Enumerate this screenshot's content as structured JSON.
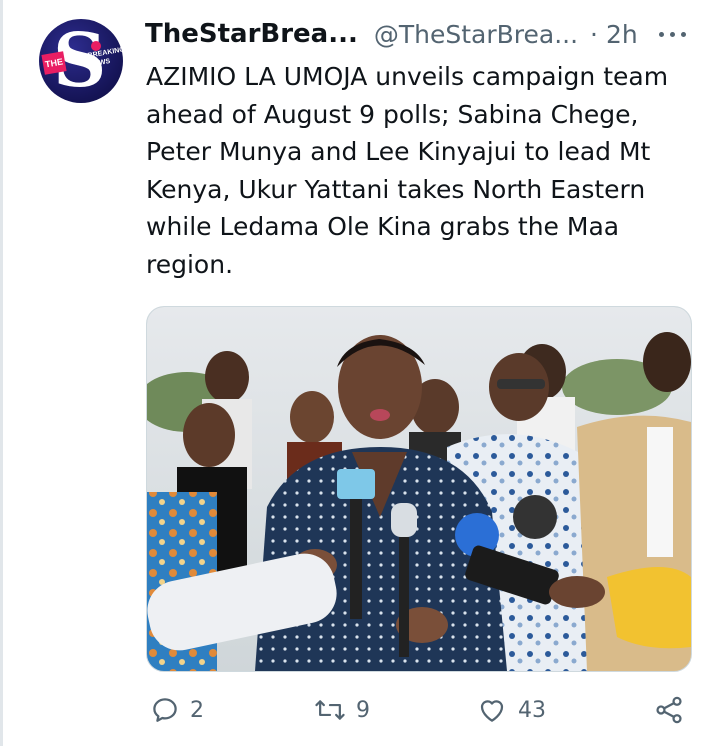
{
  "tweet": {
    "author_name": "TheStarBrea...",
    "author_handle": "@TheStarBrea...",
    "separator": "·",
    "time": "2h",
    "avatar": {
      "label_the": "THE",
      "label_breaking": "BREAKING",
      "label_news": "NEWS",
      "letter": "S"
    },
    "text_lines": [
      "AZIMIO LA UMOJA unveils campaign team",
      "ahead of August 9 polls; Sabina Chege,",
      "Peter Munya and Lee Kinyajui to lead Mt",
      "Kenya, Ukur Yattani takes North Eastern",
      "while Ledama Ole Kina grabs the Maa",
      "region."
    ],
    "media": {
      "description": "press-conference-photo"
    }
  },
  "actions": {
    "reply_count": "2",
    "retweet_count": "9",
    "like_count": "43",
    "icons": [
      "reply-icon",
      "retweet-icon",
      "like-icon",
      "share-icon"
    ]
  },
  "colors": {
    "text_primary": "#0f1419",
    "text_secondary": "#536471",
    "border": "#cfd9de",
    "avatar_bg": "#1b1a63",
    "avatar_accent": "#e91e63"
  }
}
